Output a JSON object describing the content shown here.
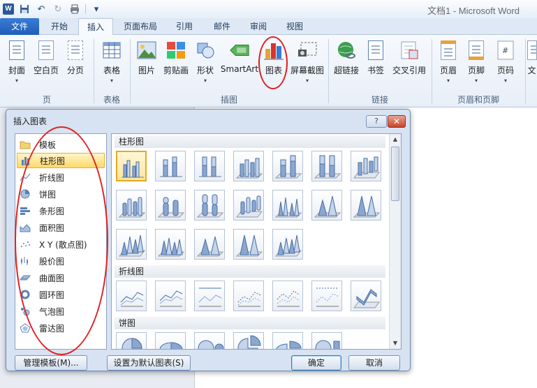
{
  "window": {
    "title": "文档1 - Microsoft Word",
    "app_logo": "W"
  },
  "qat": {
    "save_icon": "save-icon",
    "undo_icon": "undo-icon",
    "redo_icon": "redo-icon",
    "print_icon": "print-icon",
    "customize": "▾"
  },
  "tabs": [
    {
      "label": "文件"
    },
    {
      "label": "开始"
    },
    {
      "label": "插入"
    },
    {
      "label": "页面布局"
    },
    {
      "label": "引用"
    },
    {
      "label": "邮件"
    },
    {
      "label": "审阅"
    },
    {
      "label": "视图"
    }
  ],
  "ribbon": {
    "buttons": [
      {
        "label": "封面"
      },
      {
        "label": "空白页"
      },
      {
        "label": "分页"
      },
      {
        "label": "表格"
      },
      {
        "label": "图片"
      },
      {
        "label": "剪贴画"
      },
      {
        "label": "形状"
      },
      {
        "label": "SmartArt"
      },
      {
        "label": "图表"
      },
      {
        "label": "屏幕截图"
      },
      {
        "label": "超链接"
      },
      {
        "label": "书签"
      },
      {
        "label": "交叉引用"
      },
      {
        "label": "页眉"
      },
      {
        "label": "页脚"
      },
      {
        "label": "页码"
      },
      {
        "label": "文"
      }
    ],
    "groups": [
      "页",
      "表格",
      "插图",
      "链接",
      "页眉和页脚"
    ]
  },
  "dialog": {
    "title": "插入图表",
    "help_label": "?",
    "close_label": "✕",
    "categories": [
      {
        "label": "模板"
      },
      {
        "label": "柱形图"
      },
      {
        "label": "折线图"
      },
      {
        "label": "饼图"
      },
      {
        "label": "条形图"
      },
      {
        "label": "面积图"
      },
      {
        "label": "X Y (散点图)"
      },
      {
        "label": "股价图"
      },
      {
        "label": "曲面图"
      },
      {
        "label": "圆环图"
      },
      {
        "label": "气泡图"
      },
      {
        "label": "雷达图"
      }
    ],
    "sections": {
      "column": "柱形图",
      "line": "折线图",
      "pie": "饼图"
    },
    "buttons": {
      "manage": "管理模板(M)...",
      "set_default": "设置为默认图表(S)",
      "ok": "确定",
      "cancel": "取消"
    }
  }
}
